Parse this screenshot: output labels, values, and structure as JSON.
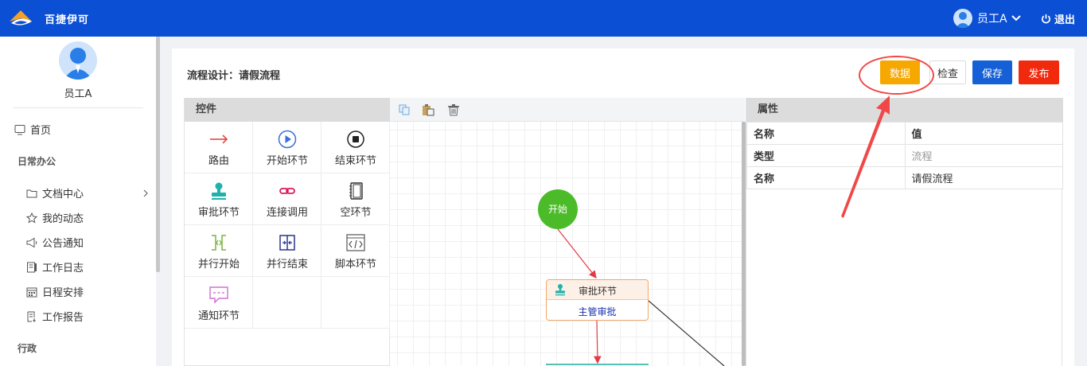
{
  "header": {
    "app_title": "百捷伊可",
    "user_name": "员工A",
    "logout_label": "退出"
  },
  "sidebar": {
    "user_name": "员工A",
    "home_label": "首页",
    "section_daily": "日常办公",
    "items": [
      {
        "label": "文档中心",
        "icon": "folder-icon"
      },
      {
        "label": "我的动态",
        "icon": "star-icon"
      },
      {
        "label": "公告通知",
        "icon": "megaphone-icon"
      },
      {
        "label": "工作日志",
        "icon": "journal-icon"
      },
      {
        "label": "日程安排",
        "icon": "calendar-icon"
      },
      {
        "label": "工作报告",
        "icon": "report-icon"
      }
    ],
    "section_admin": "行政"
  },
  "main": {
    "title": "流程设计：请假流程",
    "buttons": {
      "data": "数据",
      "check": "检查",
      "save": "保存",
      "publish": "发布"
    }
  },
  "controls": {
    "title": "控件",
    "items": [
      {
        "label": "路由",
        "icon": "arrow-right-icon"
      },
      {
        "label": "开始环节",
        "icon": "play-circle-icon"
      },
      {
        "label": "结束环节",
        "icon": "stop-circle-icon"
      },
      {
        "label": "审批环节",
        "icon": "stamp-icon"
      },
      {
        "label": "连接调用",
        "icon": "link-icon"
      },
      {
        "label": "空环节",
        "icon": "notebook-icon"
      },
      {
        "label": "并行开始",
        "icon": "split-icon"
      },
      {
        "label": "并行结束",
        "icon": "merge-icon"
      },
      {
        "label": "脚本环节",
        "icon": "code-icon"
      },
      {
        "label": "通知环节",
        "icon": "message-icon"
      }
    ]
  },
  "canvas": {
    "toolbar": [
      "copy-icon",
      "paste-icon",
      "trash-icon"
    ],
    "start_node": "开始",
    "approve_node": {
      "title": "审批环节",
      "subtitle": "主管审批"
    }
  },
  "properties": {
    "title": "属性",
    "columns": [
      "名称",
      "值"
    ],
    "rows": [
      {
        "key": "类型",
        "value": "流程"
      },
      {
        "key": "名称",
        "value": "请假流程"
      }
    ]
  },
  "colors": {
    "topbar": "#0b4fd4",
    "data_button": "#f7a800",
    "save_button": "#1560d6",
    "publish_button": "#f12a0e",
    "start_node": "#4cbb29",
    "annotation": "#f04848"
  }
}
